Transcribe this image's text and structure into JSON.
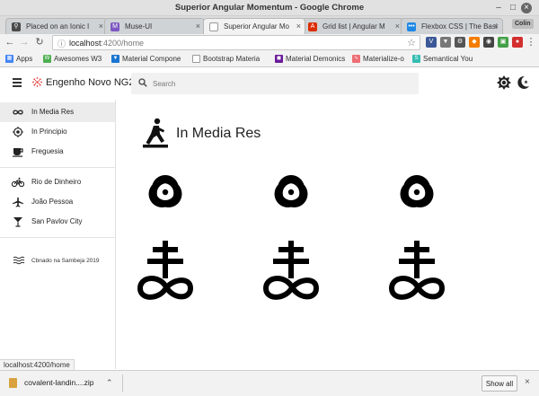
{
  "window": {
    "title": "Superior Angular Momentum - Google Chrome",
    "controls": [
      "Minimize",
      "Maximize",
      "Close"
    ]
  },
  "tabs": [
    {
      "label": "Placed on an Ionic I",
      "favicon": "bicycle-icon",
      "color": "#4a4a4a",
      "active": false
    },
    {
      "label": "Muse-UI",
      "favicon": "muse-ui-icon",
      "color": "#7e57c2",
      "active": false
    },
    {
      "label": "Superior Angular Mo",
      "favicon": "page-icon",
      "color": "#9e9e9e",
      "active": true
    },
    {
      "label": "Grid list | Angular M",
      "favicon": "angular-icon",
      "color": "#dd2c00",
      "active": false
    },
    {
      "label": "Flexbox CSS | The Basi",
      "favicon": "dots-icon",
      "color": "#1e88e5",
      "active": false
    }
  ],
  "profile_badge": "Colin",
  "omnibox": {
    "host": "localhost",
    "path": ":4200/home"
  },
  "bookmarks": [
    {
      "label": "Apps",
      "icon": "apps-grid-icon",
      "color": "#4285f4"
    },
    {
      "label": "Awesomes W3",
      "icon": "w3-icon",
      "color": "#4caf50"
    },
    {
      "label": "Material Compone",
      "icon": "material-icon",
      "color": "#1976d2"
    },
    {
      "label": "Bootstrap Materia",
      "icon": "page-icon",
      "color": "#9e9e9e"
    },
    {
      "label": "Material Demonics",
      "icon": "demonics-icon",
      "color": "#6a1b9a"
    },
    {
      "label": "Materialize-o",
      "icon": "materialize-icon",
      "color": "#ee6e73"
    },
    {
      "label": "Semantical You",
      "icon": "semantic-icon",
      "color": "#35bdb2"
    }
  ],
  "app": {
    "brand": "Engenho Novo NG2",
    "search_placeholder": "Search",
    "brand_color": "#e53935"
  },
  "sidebar": {
    "group1": [
      {
        "label": "In Media Res",
        "icon": "infinity-icon",
        "active": true
      },
      {
        "label": "In Principio",
        "icon": "target-icon",
        "active": false
      },
      {
        "label": "Freguesia",
        "icon": "coffee-cup-icon",
        "active": false
      }
    ],
    "group2": [
      {
        "label": "Rio de Dinheiro",
        "icon": "bicycle-icon",
        "active": false
      },
      {
        "label": "João Pessoa",
        "icon": "airplane-icon",
        "active": false
      },
      {
        "label": "San Pavlov City",
        "icon": "cocktail-icon",
        "active": false
      }
    ],
    "footnote": "Cbnado na Sambeja 2019"
  },
  "main": {
    "title": "In Media Res",
    "title_icon": "person-walking-icon",
    "grid_rows": [
      [
        "biohazard-symbol",
        "biohazard-symbol",
        "biohazard-symbol"
      ],
      [
        "leviathan-cross-symbol",
        "leviathan-cross-symbol",
        "leviathan-cross-symbol"
      ]
    ]
  },
  "status_url": "localhost:4200/home",
  "download": {
    "filename": "covalent-landin....zip",
    "show_all": "Show all"
  }
}
